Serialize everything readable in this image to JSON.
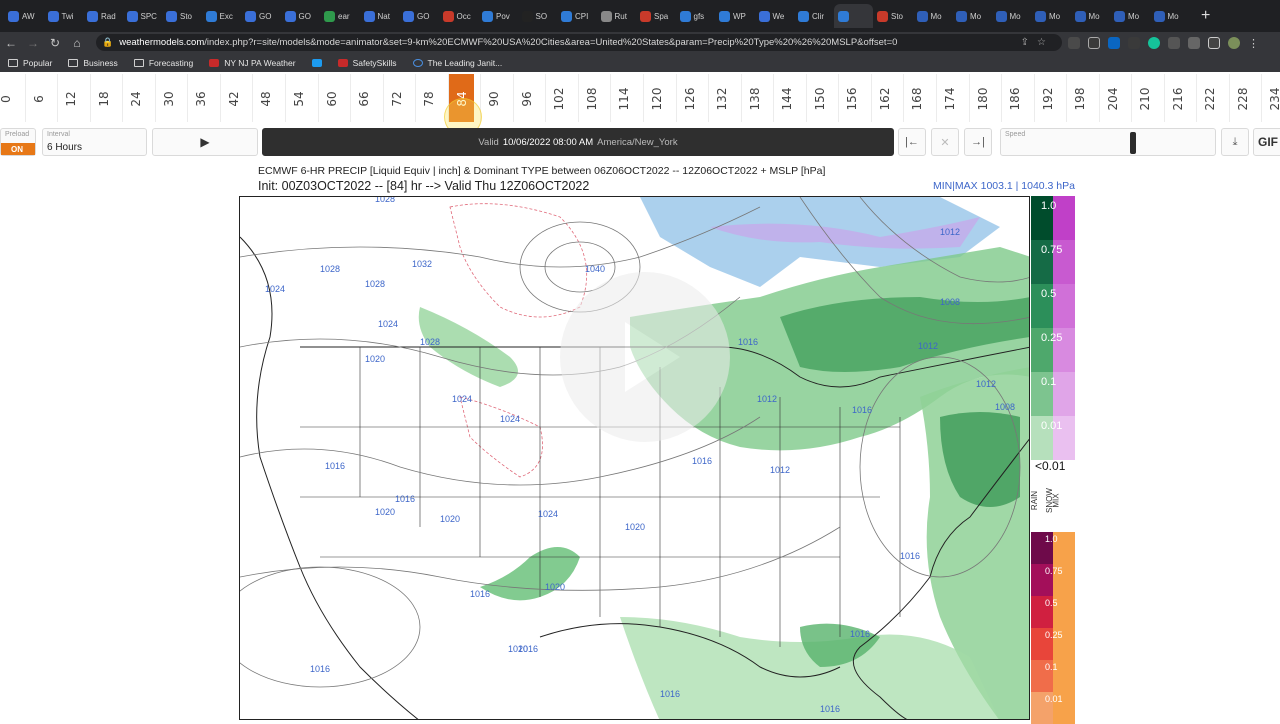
{
  "browser": {
    "tabs": [
      {
        "label": "AW",
        "color": "#3a6fd8"
      },
      {
        "label": "Twi",
        "color": "#3a6fd8"
      },
      {
        "label": "Rad",
        "color": "#3a6fd8"
      },
      {
        "label": "SPC",
        "color": "#3a6fd8"
      },
      {
        "label": "Sto",
        "color": "#3a6fd8"
      },
      {
        "label": "Exc",
        "color": "#2f7bd6"
      },
      {
        "label": "GO",
        "color": "#3a6fd8"
      },
      {
        "label": "GO",
        "color": "#3a6fd8"
      },
      {
        "label": "ear",
        "color": "#2f9a4c"
      },
      {
        "label": "Nat",
        "color": "#3a6fd8"
      },
      {
        "label": "GO",
        "color": "#3a6fd8"
      },
      {
        "label": "Occ",
        "color": "#c83a2a"
      },
      {
        "label": "Pov",
        "color": "#2f7bd6"
      },
      {
        "label": "SO",
        "color": "#222"
      },
      {
        "label": "CPI",
        "color": "#2f7bd6"
      },
      {
        "label": "Rut",
        "color": "#888"
      },
      {
        "label": "Spa",
        "color": "#c83a2a"
      },
      {
        "label": "gfs",
        "color": "#2f7bd6"
      },
      {
        "label": "WP",
        "color": "#2f7bd6"
      },
      {
        "label": "We",
        "color": "#3a6fd8"
      },
      {
        "label": "Clir",
        "color": "#2f7bd6"
      },
      {
        "label": "",
        "color": "#2f7bd6"
      },
      {
        "label": "Sto",
        "color": "#c83a2a"
      },
      {
        "label": "Mo",
        "color": "#2f5fb8"
      },
      {
        "label": "Mo",
        "color": "#2f5fb8"
      },
      {
        "label": "Mo",
        "color": "#2f5fb8"
      },
      {
        "label": "Mo",
        "color": "#2f5fb8"
      },
      {
        "label": "Mo",
        "color": "#2f5fb8"
      },
      {
        "label": "Mo",
        "color": "#2f5fb8"
      },
      {
        "label": "Mo",
        "color": "#2f5fb8"
      }
    ],
    "active_tab_index": 21,
    "new_tab": "+",
    "url_host": "weathermodels.com",
    "url_path": "/index.php?r=site/models&mode=animator&set=9-km%20ECMWF%20USA%20Cities&area=United%20States&param=Precip%20Type%20%26%20MSLP&offset=0",
    "bookmarks": [
      {
        "label": "Popular",
        "icon": "folder"
      },
      {
        "label": "Business",
        "icon": "folder"
      },
      {
        "label": "Forecasting",
        "icon": "folder"
      },
      {
        "label": "NY NJ PA Weather",
        "icon": "red"
      },
      {
        "label": "",
        "icon": "tw"
      },
      {
        "label": "SafetySkills",
        "icon": "red"
      },
      {
        "label": "The Leading Janit...",
        "icon": "circ"
      }
    ]
  },
  "timeline": {
    "hours": [
      "0",
      "6",
      "12",
      "18",
      "24",
      "30",
      "36",
      "42",
      "48",
      "54",
      "60",
      "66",
      "72",
      "78",
      "84",
      "90",
      "96",
      "102",
      "108",
      "114",
      "120",
      "126",
      "132",
      "138",
      "144",
      "150",
      "156",
      "162",
      "168",
      "174",
      "180",
      "186",
      "192",
      "198",
      "204",
      "210",
      "216",
      "222",
      "228",
      "234"
    ],
    "selected": "84"
  },
  "controls": {
    "preload_label": "Preload",
    "preload_state": "ON",
    "interval_label": "Interval",
    "interval_value": "6 Hours",
    "valid_prefix": "Valid",
    "valid_time": "10/06/2022 08:00 AM",
    "valid_tz": "America/New_York",
    "speed_label": "Speed",
    "gif_label": "GIF"
  },
  "map": {
    "title": "ECMWF 6-HR PRECIP [Liquid Equiv | inch] & Dominant TYPE between 06Z06OCT2022 -- 12Z06OCT2022 + MSLP [hPa]",
    "subtitle": "Init: 00Z03OCT2022 -- [84] hr --> Valid Thu 12Z06OCT2022",
    "minmax": "MIN|MAX 1003.1 | 1040.3 hPa",
    "isobar_labels": [
      "1028",
      "1028",
      "1032",
      "1028",
      "1024",
      "1024",
      "1028",
      "1020",
      "1024",
      "1024",
      "1016",
      "1016",
      "1020",
      "1020",
      "1024",
      "1016",
      "1020",
      "1016",
      "1020",
      "1016",
      "1016",
      "1016",
      "1012",
      "1008",
      "1012",
      "1012",
      "1016",
      "1016",
      "1008",
      "1016",
      "1016",
      "1016",
      "1040",
      "1012",
      "1012",
      "1020"
    ]
  },
  "legend": {
    "green": [
      "1.0",
      "0.75",
      "0.5",
      "0.25",
      "0.1",
      "0.01"
    ],
    "lt": "<0.01",
    "types": [
      "RAIN",
      "SNOW",
      "MIX"
    ],
    "red": [
      "1.0",
      "0.75",
      "0.5",
      "0.25",
      "0.1",
      "0.01"
    ]
  }
}
